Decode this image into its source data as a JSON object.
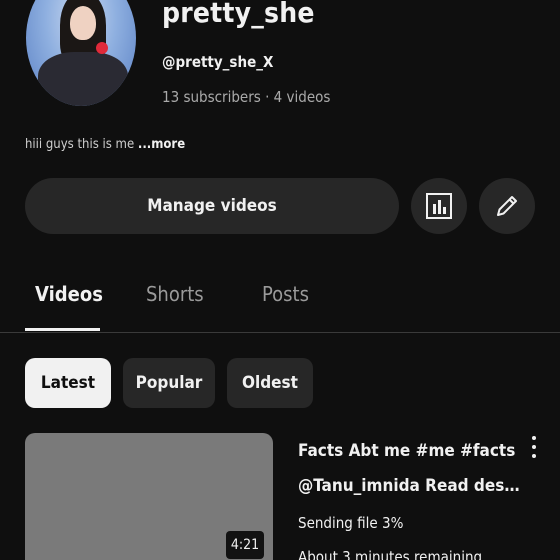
{
  "channel": {
    "name": "pretty_she",
    "handle": "@pretty_she_X",
    "stats": "13 subscribers · 4 videos",
    "bio_text": "hiii guys this is me ",
    "bio_more": "...more"
  },
  "actions": {
    "manage_label": "Manage videos",
    "analytics_icon": "analytics-icon",
    "edit_icon": "pencil-icon"
  },
  "tabs": [
    {
      "label": "Videos",
      "active": true
    },
    {
      "label": "Shorts",
      "active": false
    },
    {
      "label": "Posts",
      "active": false
    }
  ],
  "filters": [
    {
      "label": "Latest",
      "selected": true
    },
    {
      "label": "Popular",
      "selected": false
    },
    {
      "label": "Oldest",
      "selected": false
    }
  ],
  "videos": [
    {
      "title": "Facts Abt me #me #facts",
      "description": "@Tanu_imnida Read descr...",
      "status": "Sending file 3%",
      "eta": "About 3 minutes remaining",
      "duration": "4:21"
    }
  ],
  "colors": {
    "background": "#0f0f0f",
    "surface": "#272727",
    "text": "#f1f1f1",
    "muted": "#aaaaaa"
  }
}
